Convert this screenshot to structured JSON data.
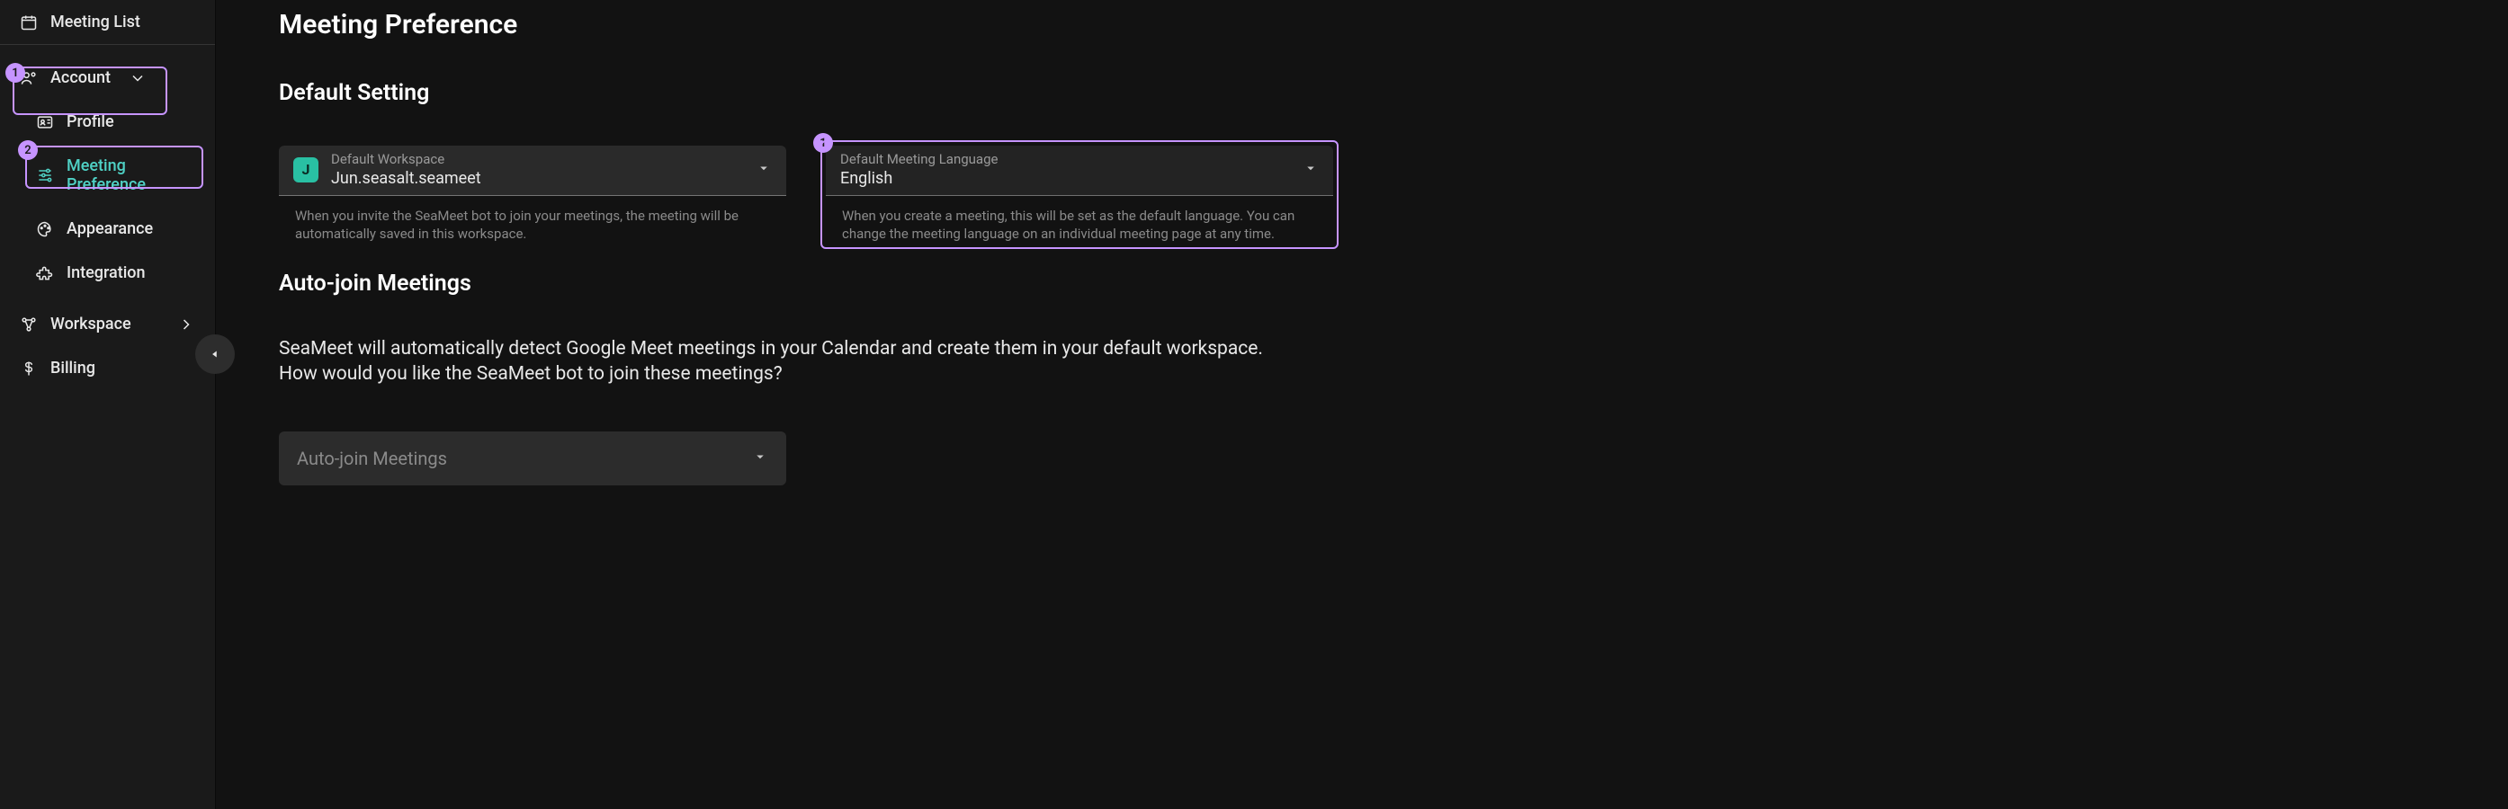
{
  "sidebar": {
    "meeting_list": "Meeting List",
    "account": "Account",
    "profile": "Profile",
    "meeting_preference": "Meeting Preference",
    "appearance": "Appearance",
    "integration": "Integration",
    "workspace": "Workspace",
    "billing": "Billing"
  },
  "page": {
    "title": "Meeting Preference",
    "default_setting_title": "Default Setting",
    "autojoin_title": "Auto-join Meetings",
    "autojoin_desc_1": "SeaMeet will automatically detect Google Meet meetings in your Calendar and create them in your default workspace.",
    "autojoin_desc_2": "How would you like the SeaMeet bot to join these meetings?"
  },
  "workspace_field": {
    "label": "Default Workspace",
    "value": "Jun.seasalt.seameet",
    "avatar_initial": "J",
    "helper": "When you invite the SeaMeet bot to join your meetings, the meeting will be automatically saved in this workspace."
  },
  "language_field": {
    "label": "Default Meeting Language",
    "value": "English",
    "helper": "When you create a meeting, this will be set as the default language. You can change the meeting language on an individual meeting page at any time."
  },
  "autojoin_field": {
    "placeholder": "Auto-join Meetings"
  },
  "annotations": {
    "one": "1",
    "two": "2"
  }
}
